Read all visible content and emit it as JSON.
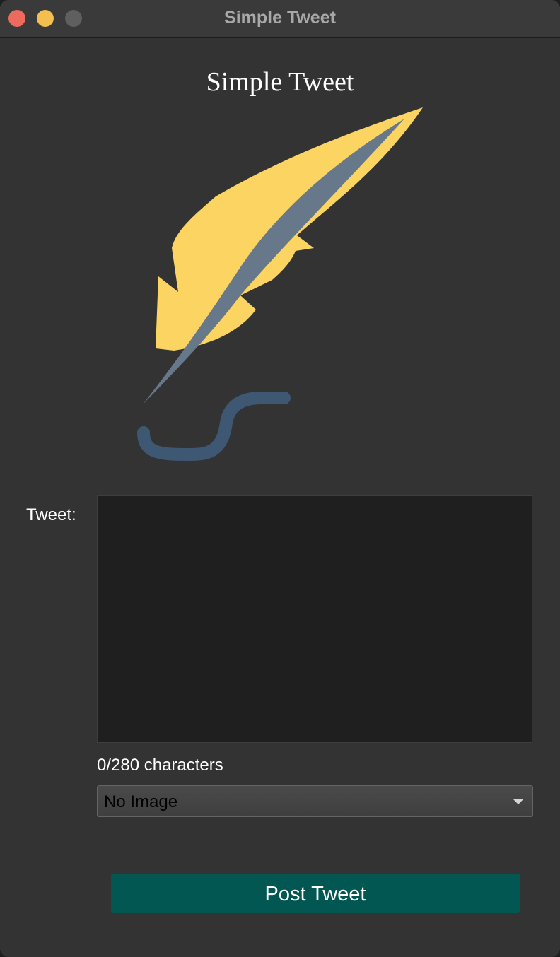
{
  "window": {
    "title": "Simple Tweet",
    "controls": [
      {
        "name": "close",
        "color": "#ec6a5e"
      },
      {
        "name": "minimize",
        "color": "#f4bf4f"
      },
      {
        "name": "zoom",
        "color": "#5f5f5f"
      }
    ]
  },
  "app": {
    "heading": "Simple Tweet",
    "logo": {
      "icon": "feather-quill-icon",
      "feather_color": "#fcd462",
      "shaft_color": "#66788a",
      "ink_color": "#3e5873"
    }
  },
  "form": {
    "tweet_label": "Tweet:",
    "tweet_value": "",
    "char_count": "0/280 characters",
    "image_select": {
      "selected": "No Image"
    },
    "post_button": "Post Tweet"
  },
  "colors": {
    "background": "#333333",
    "textarea_bg": "#1f1f1f",
    "button_bg": "#035752"
  }
}
